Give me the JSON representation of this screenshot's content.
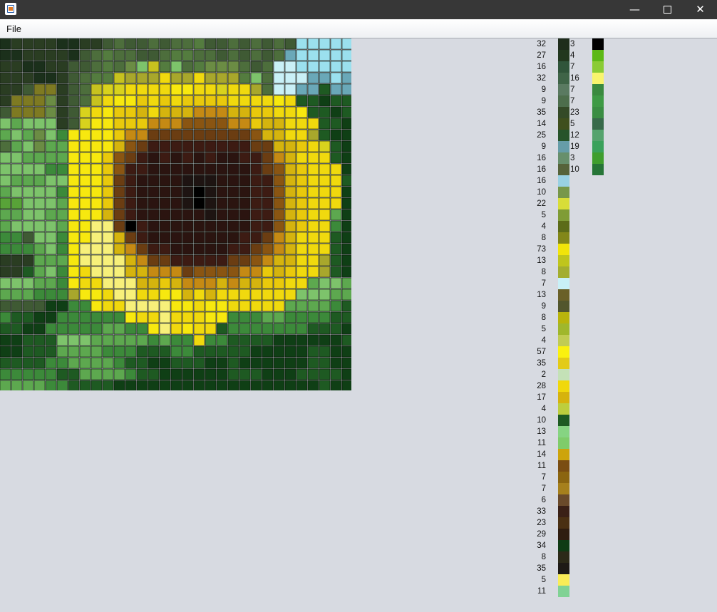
{
  "window": {
    "icon": "java-app-icon",
    "minimize_glyph": "—",
    "close_glyph": "✕"
  },
  "menu": {
    "file": "File"
  },
  "mosaic_grid": {
    "cols": 31,
    "rows": 31,
    "palette": {
      "a": "#1b301b",
      "b": "#2a3d22",
      "c": "#3f5a34",
      "d": "#4d6e3c",
      "e": "#547c3f",
      "f": "#6b8c44",
      "g": "#7dc36b",
      "h": "#5da84f",
      "i": "#3c8a3a",
      "j": "#1e5a22",
      "k": "#0f3f15",
      "l": "#63a84e",
      "m": "#9be0ee",
      "n": "#6aa8b8",
      "o": "#c9f0f7",
      "p": "#536a2a",
      "q": "#7e7a22",
      "r": "#8f8a2f",
      "s": "#a8a72c",
      "t": "#c7c21f",
      "u": "#d8d21d",
      "v": "#f0d90e",
      "w": "#f7e80f",
      "x": "#e9c90c",
      "y": "#d5b40e",
      "z": "#f7f07a",
      "A": "#c58a14",
      "B": "#8a5512",
      "C": "#6b3d12",
      "D": "#3d1b13",
      "E": "#2b1410",
      "F": "#1e1412",
      "G": "#000000",
      "H": "#4e6b24",
      "I": "#58a338"
    },
    "rows_data": [
      "abbbbaabbcdccdcddeccdcdcdcmmmmm",
      "aabbbbacdeddccdeeddcdcdcdnmmmmm",
      "bbaabbccdedfgtegdefffdcdoommmmm",
      "bbbaabcdeetsssvssvsssegdooonnmn",
      "bbcqqbcdtuuvvvvwwvvuvvsdoonnjnn",
      "bqqqfbcdtvwwxvxvxxxxvvvvwvjjkjj",
      "cqqqfbcuvwxxyvyyyAAAyyxxvvwjjkj",
      "ghgggbcuwwxxxAAABBBBAAxyyvvvjjk",
      "hghfgiwwwwxAACCCCCCCCCByyvvsjkk",
      "dhgfhhwwwwyBCDDDDDDDDDCCyyxvujk",
      "gghhhhwwwxBCDEDEDEDEEDDCAyvvvjk",
      "ggggiiwwwxBDDEEEEEEEEEDCByxvvvk",
      "ghhhggwwwxCDEEEEFFFEEEDDByxvvvj",
      "hggggiwwwxCDEEEEFGFEEEDDByxvvvk",
      "IIggghwwwxCDEEEEFGFEEEDDByxvvvk",
      "hhgghhwwwyCDEEEEEEFEEEDDByxvvhk",
      "hgggghwwzzCGDEEEEEEEEEDDByxvvik",
      "iicggiwwzzyCDEEEEEEEEDDCAyvvvjk",
      "iiihgiwzzzyACDDEEEEEDDCBAyvvvjk",
      "bbbhhhwzzzzyACCDDDDDCCBAyyvvsjk",
      "bbjhgiwvzzzyyAAACBBBBAAxyxvvsjk",
      "ggghhiwvvzzzyyxyAAAyAyyxxvvhggh",
      "hhhiiiswwvzzvvwwyvyvvvvvvvggghh",
      "cccckkiiwvvzzzzwwvwwvvvvvhhhhij",
      "ijjkkiiiiiiwvvzvvvwwiiihhiiiijj",
      "jjkkiiiiihhiiwzvwvvjiiiiiiijjjk",
      "kkjjjggghhhhhihiiviijjjjkkkkkkj",
      "kkjjjhhhhiiijjjiijjjjjkkkkkjjkk",
      "jjjjiihhhhijjkkjjjkkjkkkkkkjjkk",
      "iiiiijjhhhhijjkkkkkkjjjkkkjjjjk",
      "hhhhiijjjjkkkkkkkkkkkkkkkkkkjkk"
    ]
  },
  "palette_list": [
    {
      "count": "32",
      "color": "#1f2d1c"
    },
    {
      "count": "27",
      "color": "#22381e"
    },
    {
      "count": "16",
      "color": "#30553a"
    },
    {
      "count": "32",
      "color": "#3f6447"
    },
    {
      "count": "9",
      "color": "#5a7a61"
    },
    {
      "count": "9",
      "color": "#4d6e4c"
    },
    {
      "count": "35",
      "color": "#344a27"
    },
    {
      "count": "14",
      "color": "#3f4f1d"
    },
    {
      "count": "25",
      "color": "#27542a"
    },
    {
      "count": "9",
      "color": "#669da8"
    },
    {
      "count": "16",
      "color": "#678f6c"
    },
    {
      "count": "16",
      "color": "#56633a"
    },
    {
      "count": "16",
      "color": "#99d1e3"
    },
    {
      "count": "10",
      "color": "#77974a"
    },
    {
      "count": "22",
      "color": "#d8dd38"
    },
    {
      "count": "5",
      "color": "#7f9c36"
    },
    {
      "count": "4",
      "color": "#5c6c19"
    },
    {
      "count": "8",
      "color": "#828719"
    },
    {
      "count": "73",
      "color": "#f1e40a"
    },
    {
      "count": "13",
      "color": "#bfc51c"
    },
    {
      "count": "8",
      "color": "#a3ae2f"
    },
    {
      "count": "7",
      "color": "#c8f0f7"
    },
    {
      "count": "13",
      "color": "#6a6028"
    },
    {
      "count": "9",
      "color": "#52562d"
    },
    {
      "count": "8",
      "color": "#b9b40c"
    },
    {
      "count": "5",
      "color": "#a0b72c"
    },
    {
      "count": "4",
      "color": "#c1cc53"
    },
    {
      "count": "57",
      "color": "#faf10f"
    },
    {
      "count": "35",
      "color": "#e3cb16"
    },
    {
      "count": "2",
      "color": "#c4e1b7"
    },
    {
      "count": "28",
      "color": "#f0d80c"
    },
    {
      "count": "17",
      "color": "#d6b30d"
    },
    {
      "count": "4",
      "color": "#bdce3d"
    },
    {
      "count": "10",
      "color": "#1e5b22"
    },
    {
      "count": "13",
      "color": "#86d482"
    },
    {
      "count": "11",
      "color": "#7fcc6a"
    },
    {
      "count": "14",
      "color": "#cda40c"
    },
    {
      "count": "11",
      "color": "#7a4d12"
    },
    {
      "count": "7",
      "color": "#8b6510"
    },
    {
      "count": "7",
      "color": "#a6801c"
    },
    {
      "count": "6",
      "color": "#6a4a2a"
    },
    {
      "count": "33",
      "color": "#3a2016"
    },
    {
      "count": "23",
      "color": "#4a3013"
    },
    {
      "count": "29",
      "color": "#2f1d10"
    },
    {
      "count": "34",
      "color": "#0f3b14"
    },
    {
      "count": "8",
      "color": "#2c2a18"
    },
    {
      "count": "35",
      "color": "#1e1a16"
    },
    {
      "count": "5",
      "color": "#f9ec57"
    },
    {
      "count": "11",
      "color": "#80d294"
    }
  ],
  "palette_list_2": [
    {
      "count": "3",
      "color": "#000000"
    },
    {
      "count": "4",
      "color": "#5cb815"
    },
    {
      "count": "7",
      "color": "#8acb34"
    },
    {
      "count": "16",
      "color": "#f8f46d"
    },
    {
      "count": "7",
      "color": "#3a8a3f"
    },
    {
      "count": "7",
      "color": "#3e9a45"
    },
    {
      "count": "23",
      "color": "#3a8d43"
    },
    {
      "count": "5",
      "color": "#376a4a"
    },
    {
      "count": "12",
      "color": "#55a36d"
    },
    {
      "count": "19",
      "color": "#3aa15b"
    },
    {
      "count": "3",
      "color": "#3f9e2e"
    },
    {
      "count": "10",
      "color": "#267537"
    }
  ]
}
